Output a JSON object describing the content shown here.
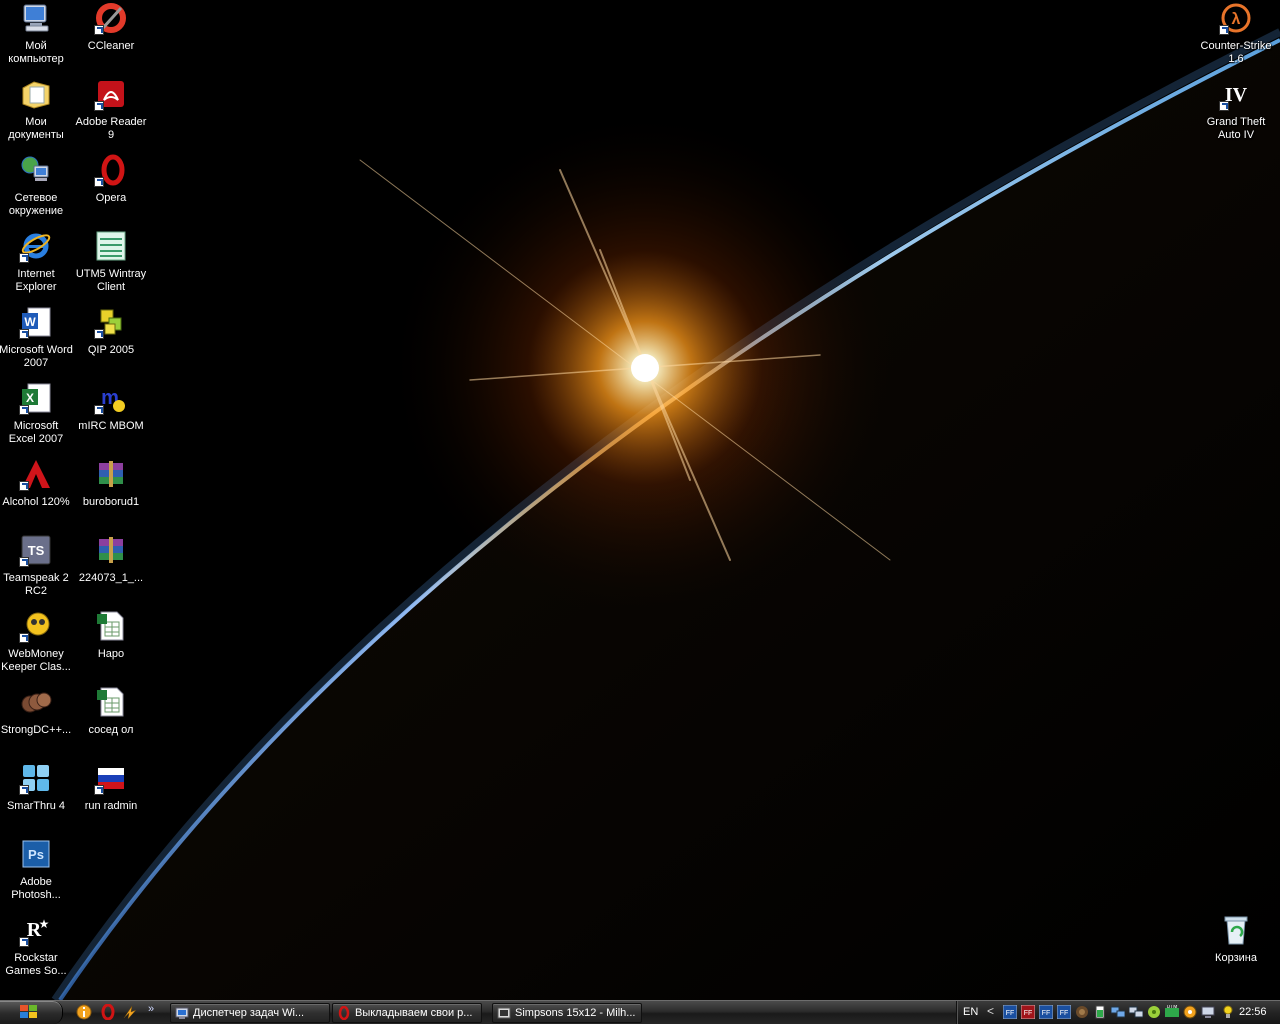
{
  "desktop": {
    "icons_left": [
      {
        "name": "Мой компьютер",
        "icon": "my-computer-icon"
      },
      {
        "name": "CCleaner",
        "icon": "ccleaner-icon"
      },
      {
        "name": "Мои документы",
        "icon": "my-documents-icon"
      },
      {
        "name": "Adobe Reader 9",
        "icon": "adobe-reader-icon"
      },
      {
        "name": "Сетевое окружение",
        "icon": "network-icon"
      },
      {
        "name": "Opera",
        "icon": "opera-icon"
      },
      {
        "name": "Internet Explorer",
        "icon": "internet-explorer-icon"
      },
      {
        "name": "UTM5 Wintray Client",
        "icon": "utm5-icon"
      },
      {
        "name": "Microsoft Word 2007",
        "icon": "word-icon"
      },
      {
        "name": "QIP 2005",
        "icon": "qip-icon"
      },
      {
        "name": "Microsoft Excel 2007",
        "icon": "excel-icon"
      },
      {
        "name": "mIRC MBOM",
        "icon": "mirc-icon"
      },
      {
        "name": "Alcohol 120%",
        "icon": "alcohol-icon"
      },
      {
        "name": "buroborud1",
        "icon": "rar-archive-icon"
      },
      {
        "name": "Teamspeak 2 RC2",
        "icon": "teamspeak-icon"
      },
      {
        "name": "224073_1_...",
        "icon": "rar-archive-icon"
      },
      {
        "name": "WebMoney Keeper Clas...",
        "icon": "webmoney-icon"
      },
      {
        "name": "Hapo",
        "icon": "excel-file-icon"
      },
      {
        "name": "StrongDC++...",
        "icon": "strongdc-icon"
      },
      {
        "name": "сосед ол",
        "icon": "excel-file-icon"
      },
      {
        "name": "SmarThru 4",
        "icon": "smarthru-icon"
      },
      {
        "name": "run radmin",
        "icon": "radmin-flag-icon"
      },
      {
        "name": "Adobe Photosh...",
        "icon": "photoshop-icon"
      },
      {
        "name": "Rockstar Games So...",
        "icon": "rockstar-icon"
      }
    ],
    "icons_right": [
      {
        "name": "Counter-Strike 1.6",
        "icon": "counter-strike-icon"
      },
      {
        "name": "Grand Theft Auto IV",
        "icon": "gta-iv-icon"
      },
      {
        "name": "Корзина",
        "icon": "recycle-bin-icon"
      }
    ]
  },
  "taskbar": {
    "start_label": "",
    "quick_launch": [
      "info-icon",
      "opera-icon",
      "winamp-icon"
    ],
    "overflow": "»",
    "tasks": [
      {
        "label": "Диспетчер задач Wi...",
        "icon": "task-manager-icon"
      },
      {
        "label": "Выкладываем свои р...",
        "icon": "opera-icon"
      },
      {
        "label": "Simpsons 15x12 - Milh...",
        "icon": "media-icon"
      }
    ],
    "tray": {
      "language": "EN",
      "expand": "<",
      "clock": "22:56"
    }
  }
}
